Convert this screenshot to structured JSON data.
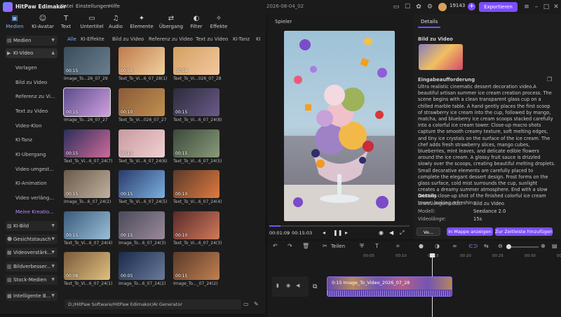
{
  "titlebar": {
    "app_name": "HitPaw Edimakor",
    "menus": [
      "Datei",
      "Einstellungen",
      "Hilfe"
    ],
    "date": "2026-08-04_02",
    "credits": "19143",
    "export_label": "Exportieren"
  },
  "toolbar": {
    "items": [
      "Medien",
      "KI-Avatar",
      "Text",
      "Untertitel",
      "Audio",
      "Elemente",
      "Übergang",
      "Filter",
      "Effekte"
    ]
  },
  "sidebar": {
    "medien": "Medien",
    "ki_video": "KI-Video",
    "sub_items": [
      "Vorlagen",
      "Bild zu Video",
      "Referenz zu Vi...",
      "Text zu Video",
      "Video-Klon",
      "KI-Tanz",
      "KI-Übergang",
      "Video umgest...",
      "KI-Animation",
      "Video verläng...",
      "Meine Kreatio..."
    ],
    "groups": [
      "KI-Bild",
      "Gesichtstausch",
      "Videoverstärk...",
      "Bildverbesser...",
      "Stock-Medien",
      "Intelligente B..."
    ]
  },
  "media": {
    "filter_tabs": [
      "Alle",
      "KI-Effekte",
      "Bild zu Video",
      "Referenz zu Video",
      "Text zu Video",
      "KI-Tanz",
      "KI"
    ],
    "items": [
      {
        "dur": "00:15",
        "name": "Image_To...26_07_29"
      },
      {
        "dur": "00:06",
        "name": "Text_To_Vi...6_07_28(1)"
      },
      {
        "dur": "00:08",
        "name": "Text_To_Vi...026_07_28"
      },
      {
        "dur": "00:15",
        "name": "Image_To...26_07_27"
      },
      {
        "dur": "00:10",
        "name": "Text_To_Vi...026_07_27"
      },
      {
        "dur": "00:15",
        "name": "Text_To_Vi...6_07_24(8)"
      },
      {
        "dur": "00:15",
        "name": "Text_To_Vi...6_07_24(7)"
      },
      {
        "dur": "00:15",
        "name": "Text_To_Vi...6_07_24(6)"
      },
      {
        "dur": "00:15",
        "name": "Text_To_Vi...6_07_24(5)"
      },
      {
        "dur": "00:15",
        "name": "Image_To...6_07_24(2)"
      },
      {
        "dur": "00:15",
        "name": "Text_To_Vi...6_07_24(5)"
      },
      {
        "dur": "00:10",
        "name": "Text_To_Vi...6_07_24(4)"
      },
      {
        "dur": "00:15",
        "name": "Text_To_Vi...6_07_24(4)"
      },
      {
        "dur": "00:15",
        "name": "Image_To...6_07_24(3)"
      },
      {
        "dur": "00:10",
        "name": "Text_To_Vi...6_07_24(3)"
      },
      {
        "dur": "00:08",
        "name": "Text_To_Vi...6_07_24(1)"
      },
      {
        "dur": "00:05",
        "name": "Image_To...6_07_24(2)"
      },
      {
        "dur": "00:15",
        "name": "Image_To..._07_24(2)"
      }
    ],
    "path": "D:/HitPaw Software/HitPaw Edimakor/AI Generator"
  },
  "player": {
    "title": "Spieler",
    "current": "00:01:09",
    "total": "00:15:03",
    "progress": 0.08
  },
  "details": {
    "tab": "Details",
    "section1": "Bild zu Video",
    "prompt_title": "Eingabeaufforderung",
    "prompt": "Ultra realistic cinematic dessert decoration video.A beautiful artisan summer ice cream creation process. The scene begins with a clean transparent glass cup on a chilled marble table. A hand gently places the first scoop of strawberry ice cream into the cup, followed by mango, matcha, and blueberry ice cream scoops stacked carefully into a colorful ice cream tower. Close-up macro shots capture the smooth creamy texture, soft melting edges, and tiny ice crystals on the surface of the ice cream. The chef adds fresh strawberry slices, mango cubes, blueberries, mint leaves, and delicate edible flowers around the ice cream. A glossy fruit sauce is drizzled slowly over the scoops, creating beautiful melting droplets. Small decorative elements are carefully placed to complete the elegant dessert design. Frost forms on the glass surface, cold mist surrounds the cup, sunlight creates a dreamy summer atmosphere. End with a slow rotating close-up shot of the finished colorful ice cream tower, looking refreshin",
    "details_title": "Details",
    "rows": [
      {
        "label": "Erstellungsmodus:",
        "value": "Bild zu Video"
      },
      {
        "label": "Modell:",
        "value": "Seedance 2.0"
      },
      {
        "label": "Videolänge:",
        "value": "15s"
      }
    ],
    "btn_small": "Ve...",
    "btn_folder": "In Mappe anzeigen",
    "btn_timeline": "Zur Zeitleiste hinzufügen"
  },
  "timeline": {
    "split_label": "Teilen",
    "ticks": [
      "00:05",
      "00:10",
      "00:15",
      "00:20",
      "00:25",
      "00:30",
      "00:35"
    ],
    "clip_label": "0:15  Image_To_Video_2026_07_28"
  }
}
